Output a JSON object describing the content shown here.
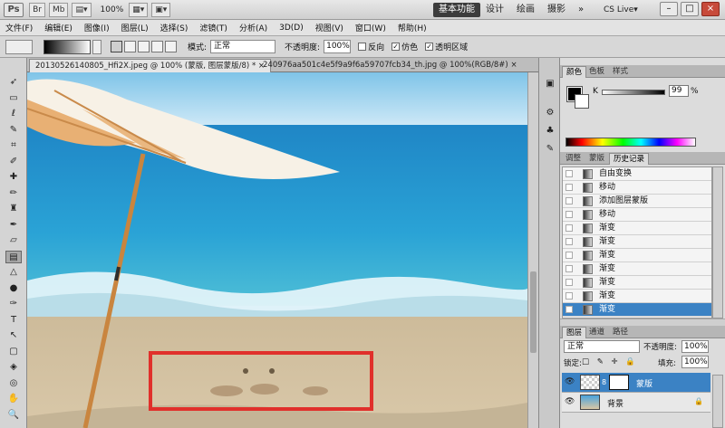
{
  "appbar": {
    "logo": "Ps",
    "buttons": [
      "Br",
      "Mb"
    ],
    "zoom": "100%",
    "workspaces": [
      "基本功能",
      "设计",
      "绘画",
      "摄影"
    ],
    "more": "»",
    "cslive": "CS Live▾",
    "window_controls": [
      "–",
      "□",
      "×"
    ]
  },
  "menubar": {
    "items": [
      "文件(F)",
      "编辑(E)",
      "图像(I)",
      "图层(L)",
      "选择(S)",
      "滤镜(T)",
      "分析(A)",
      "3D(D)",
      "视图(V)",
      "窗口(W)",
      "帮助(H)"
    ]
  },
  "options": {
    "mode_label": "模式:",
    "mode_value": "正常",
    "opacity_label": "不透明度:",
    "opacity_value": "100%",
    "reverse_label": "反向",
    "dither_label": "仿色",
    "transparency_label": "透明区域"
  },
  "tools": [
    {
      "icon": "move-icon",
      "glyph": "➶"
    },
    {
      "icon": "marquee-icon",
      "glyph": "▭"
    },
    {
      "icon": "lasso-icon",
      "glyph": "ℓ"
    },
    {
      "icon": "quick-select-icon",
      "glyph": "✎"
    },
    {
      "icon": "crop-icon",
      "glyph": "⌗"
    },
    {
      "icon": "eyedropper-icon",
      "glyph": "✐"
    },
    {
      "icon": "healing-icon",
      "glyph": "✚"
    },
    {
      "icon": "brush-icon",
      "glyph": "✏"
    },
    {
      "icon": "stamp-icon",
      "glyph": "♜"
    },
    {
      "icon": "history-brush-icon",
      "glyph": "✒"
    },
    {
      "icon": "eraser-icon",
      "glyph": "▱"
    },
    {
      "icon": "gradient-icon",
      "glyph": "▤"
    },
    {
      "icon": "blur-icon",
      "glyph": "△"
    },
    {
      "icon": "dodge-icon",
      "glyph": "●"
    },
    {
      "icon": "pen-icon",
      "glyph": "✑"
    },
    {
      "icon": "type-icon",
      "glyph": "T"
    },
    {
      "icon": "path-select-icon",
      "glyph": "↖"
    },
    {
      "icon": "shape-icon",
      "glyph": "▢"
    },
    {
      "icon": "3d-rotate-icon",
      "glyph": "◈"
    },
    {
      "icon": "3d-orbit-icon",
      "glyph": "◎"
    },
    {
      "icon": "hand-icon",
      "glyph": "✋"
    },
    {
      "icon": "zoom-icon",
      "glyph": "🔍"
    }
  ],
  "doc_tabs": [
    {
      "label": "20130526140805_Hfi2X.jpeg @ 100% (蒙版, 图层蒙版/8) *",
      "close": "×"
    },
    {
      "label": "240976aa501c4e5f9a9f6a59707fcb34_th.jpg @ 100%(RGB/8#)",
      "close": "×"
    }
  ],
  "color_panel": {
    "tabs": [
      "颜色",
      "色板",
      "样式"
    ],
    "k_label": "K",
    "k_value": "99",
    "k_pct": "%"
  },
  "history_panel": {
    "tabs": [
      "调整",
      "蒙版",
      "历史记录"
    ],
    "items": [
      "自由变换",
      "移动",
      "添加图层蒙版",
      "移动",
      "渐变",
      "渐变",
      "渐变",
      "渐变",
      "渐变",
      "渐变",
      "渐变"
    ],
    "selected_index": 10
  },
  "layers_panel": {
    "tabs": [
      "图层",
      "通道",
      "路径"
    ],
    "mode": "正常",
    "opacity_label": "不透明度:",
    "opacity_value": "100%",
    "lock_label": "锁定:",
    "lock_icons": "□ ✎ ✛ 🔒",
    "fill_label": "填充:",
    "fill_value": "100%",
    "layers": [
      {
        "name": "蒙版",
        "selected": true
      },
      {
        "name": "背景",
        "selected": false,
        "locked": true
      }
    ]
  },
  "colors": {
    "selection_blue": "#3b82c4",
    "annotation_red": "#e0302b"
  }
}
